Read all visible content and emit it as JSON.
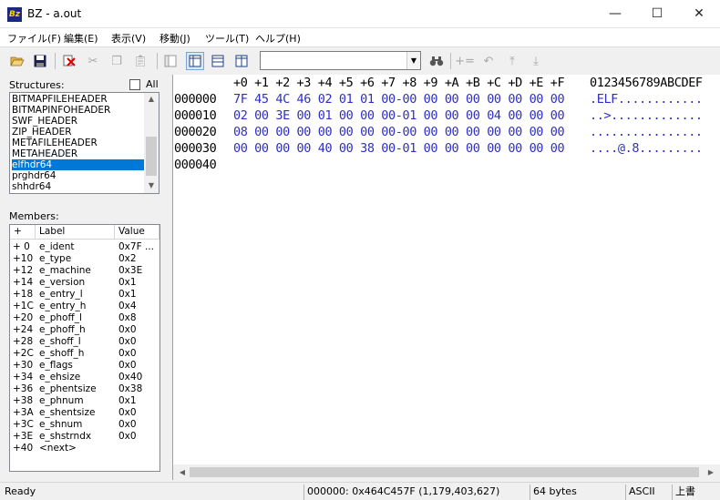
{
  "window": {
    "title": "BZ - a.out",
    "icon_text": "Bz",
    "controls": {
      "minimize": "—",
      "maximize": "☐",
      "close": "✕"
    }
  },
  "menu": [
    "ファイル(F)",
    "編集(E)",
    "表示(V)",
    "移動(J)",
    "ツール(T)",
    "ヘルプ(H)"
  ],
  "toolbar": {
    "combo_value": "",
    "icons": [
      "open-folder",
      "save",
      "delete-mark",
      "cut",
      "copy",
      "paste",
      "view-single",
      "view-split-vertical",
      "view-split-horizontal",
      "view-compare",
      "find",
      "add-equal",
      "undo",
      "jump-top",
      "jump-bottom"
    ]
  },
  "structures": {
    "label": "Structures:",
    "all_label": "All",
    "all_checked": false,
    "items": [
      "BITMAPFILEHEADER",
      "BITMAPINFOHEADER",
      "SWF_HEADER",
      "ZIP_HEADER",
      "METAFILEHEADER",
      "METAHEADER",
      "elfhdr64",
      "prghdr64",
      "shhdr64"
    ],
    "selected": "elfhdr64"
  },
  "members": {
    "label": "Members:",
    "columns": [
      "+",
      "Label",
      "Value"
    ],
    "rows": [
      [
        "+ 0",
        "e_ident",
        "0x7F ..."
      ],
      [
        "+10",
        "e_type",
        "0x2"
      ],
      [
        "+12",
        "e_machine",
        "0x3E"
      ],
      [
        "+14",
        "e_version",
        "0x1"
      ],
      [
        "+18",
        "e_entry_l",
        "0x1"
      ],
      [
        "+1C",
        "e_entry_h",
        "0x4"
      ],
      [
        "+20",
        "e_phoff_l",
        "0x8"
      ],
      [
        "+24",
        "e_phoff_h",
        "0x0"
      ],
      [
        "+28",
        "e_shoff_l",
        "0x0"
      ],
      [
        "+2C",
        "e_shoff_h",
        "0x0"
      ],
      [
        "+30",
        "e_flags",
        "0x0"
      ],
      [
        "+34",
        "e_ehsize",
        "0x40"
      ],
      [
        "+36",
        "e_phentsize",
        "0x38"
      ],
      [
        "+38",
        "e_phnum",
        "0x1"
      ],
      [
        "+3A",
        "e_shentsize",
        "0x0"
      ],
      [
        "+3C",
        "e_shnum",
        "0x0"
      ],
      [
        "+3E",
        "e_shstrndx",
        "0x0"
      ],
      [
        "+40",
        " <next>",
        ""
      ]
    ]
  },
  "hex": {
    "header": "+0 +1 +2 +3 +4 +5 +6 +7 +8 +9 +A +B +C +D +E +F",
    "ascii_header": "0123456789ABCDEF",
    "rows": [
      {
        "addr": "000000",
        "bytes": "7F 45 4C 46 02 01 01 00-00 00 00 00 00 00 00 00",
        "ascii": ".ELF............"
      },
      {
        "addr": "000010",
        "bytes": "02 00 3E 00 01 00 00 00-01 00 00 00 04 00 00 00",
        "ascii": "..>............."
      },
      {
        "addr": "000020",
        "bytes": "08 00 00 00 00 00 00 00-00 00 00 00 00 00 00 00",
        "ascii": "................"
      },
      {
        "addr": "000030",
        "bytes": "00 00 00 00 40 00 38 00-01 00 00 00 00 00 00 00",
        "ascii": "....@.8........."
      },
      {
        "addr": "000040",
        "bytes": "",
        "ascii": ""
      }
    ]
  },
  "status": {
    "ready": "Ready",
    "position": "000000: 0x464C457F (1,179,403,627)",
    "size": "64 bytes",
    "encoding": "ASCII",
    "mode": "上書"
  },
  "colors": {
    "selection": "#0078d7",
    "hex_text": "#2e2ec8"
  }
}
